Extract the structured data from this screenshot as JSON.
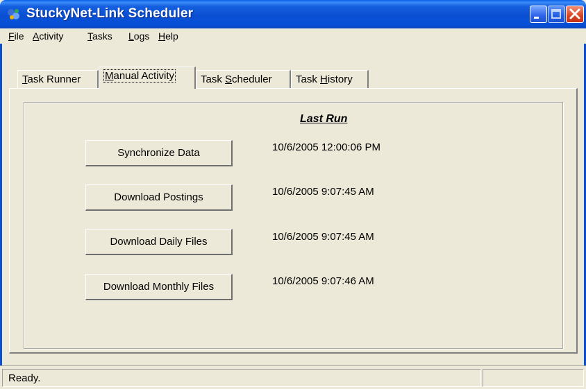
{
  "window": {
    "title": "StuckyNet-Link Scheduler"
  },
  "menu": {
    "items": [
      {
        "label": "File",
        "mnemonic": "F",
        "rest": "ile"
      },
      {
        "label": "Activity",
        "mnemonic": "A",
        "rest": "ctivity"
      },
      {
        "label": "Tasks",
        "mnemonic": "T",
        "rest": "asks"
      },
      {
        "label": "Logs",
        "mnemonic": "L",
        "rest": "ogs"
      },
      {
        "label": "Help",
        "mnemonic": "H",
        "rest": "elp"
      }
    ]
  },
  "tabs": [
    {
      "label": "Task Runner",
      "pre": "",
      "mnemonic": "T",
      "post": "ask Runner",
      "active": false
    },
    {
      "label": "Manual Activity",
      "pre": "",
      "mnemonic": "M",
      "post": "anual Activity",
      "active": true
    },
    {
      "label": "Task Scheduler",
      "pre": "Task ",
      "mnemonic": "S",
      "post": "cheduler",
      "active": false
    },
    {
      "label": "Task History",
      "pre": "Task ",
      "mnemonic": "H",
      "post": "istory",
      "active": false
    }
  ],
  "manual_activity": {
    "last_run_header": "Last Run",
    "actions": [
      {
        "button": "Synchronize Data",
        "last_run": "10/6/2005 12:00:06 PM"
      },
      {
        "button": "Download Postings",
        "last_run": "10/6/2005 9:07:45 AM"
      },
      {
        "button": "Download Daily Files",
        "last_run": "10/6/2005 9:07:45 AM"
      },
      {
        "button": "Download Monthly Files",
        "last_run": "10/6/2005 9:07:46 AM"
      }
    ]
  },
  "status": {
    "text": "Ready.",
    "pane2": ""
  },
  "colors": {
    "titlebar": "#0a4fd2",
    "face": "#ece9d8",
    "close_button": "#d9441e"
  }
}
